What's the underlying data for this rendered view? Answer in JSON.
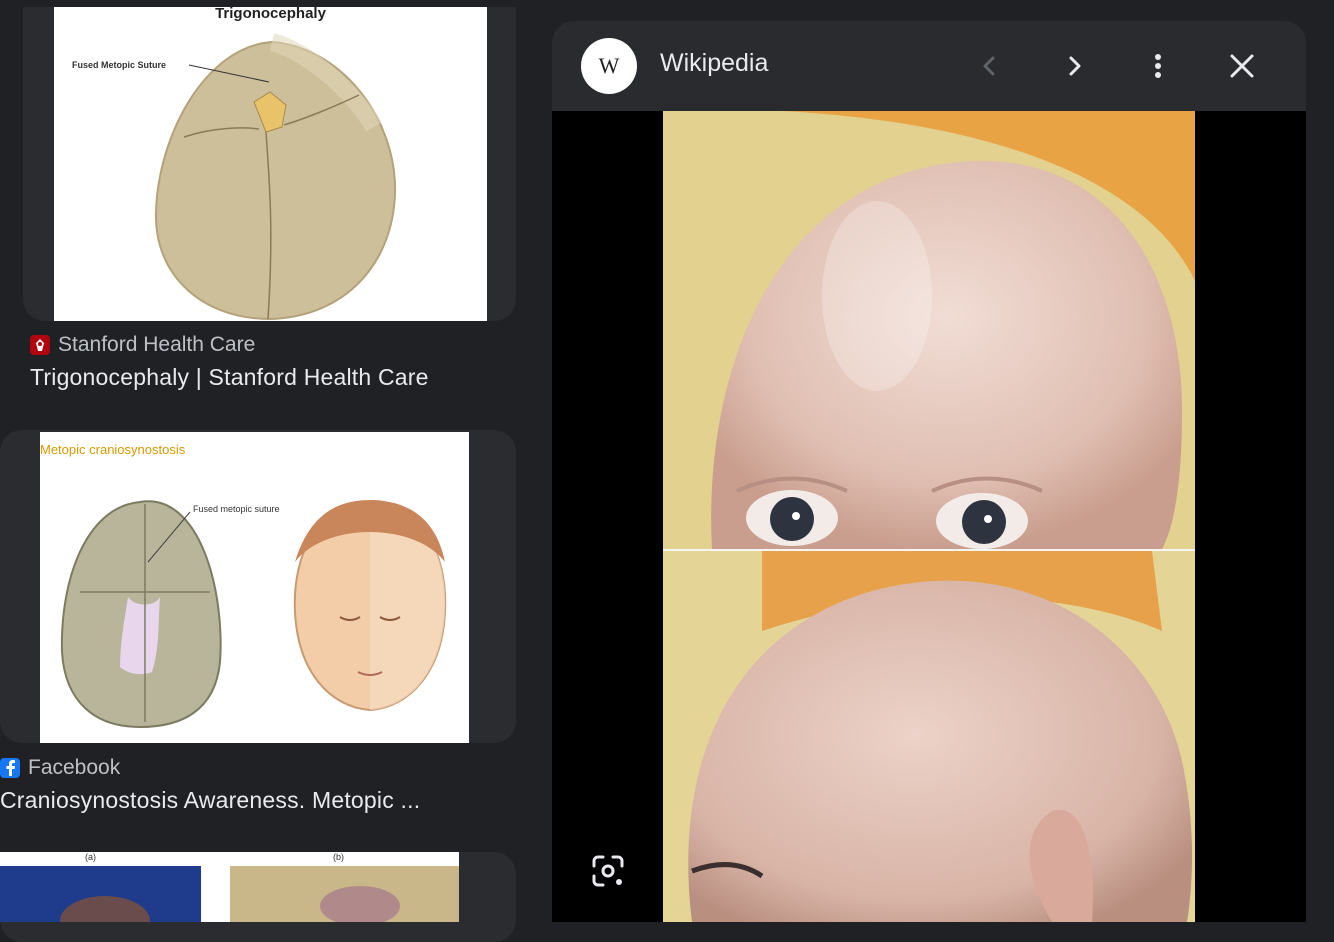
{
  "results": [
    {
      "source": "Stanford Health Care",
      "title": "Trigonocephaly | Stanford Health Care",
      "image": {
        "heading": "Trigonocephaly",
        "label": "Fused Metopic Suture"
      },
      "favicon": "stanford-favicon",
      "favicon_color": "#b1040e"
    },
    {
      "source": "Facebook",
      "title": "Craniosynostosis Awareness. Metopic ...",
      "image": {
        "heading": "Metopic craniosynostosis",
        "label": "Fused metopic suture"
      },
      "favicon": "facebook-favicon",
      "favicon_color": "#1877f2"
    },
    {
      "image": {
        "heading": "(a)",
        "heading2": "(b)"
      }
    }
  ],
  "viewer": {
    "source": "Wikipedia",
    "logo_letter": "W",
    "buttons": {
      "prev": "chevron-left-icon",
      "next": "chevron-right-icon",
      "more": "more-vert-icon",
      "close": "close-icon",
      "lens": "google-lens-icon"
    }
  },
  "colors": {
    "background": "#202124",
    "card": "#2b2c30",
    "panel_header": "#2a2b2e",
    "text_primary": "#e8eaed",
    "text_secondary": "#bdc1c6"
  }
}
